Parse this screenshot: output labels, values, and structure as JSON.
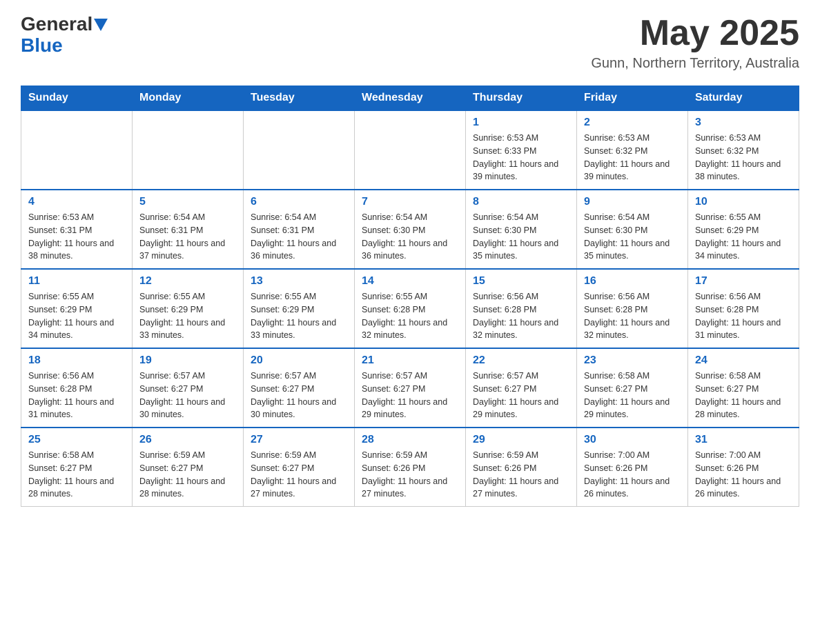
{
  "header": {
    "logo_general": "General",
    "logo_blue": "Blue",
    "month_title": "May 2025",
    "location": "Gunn, Northern Territory, Australia"
  },
  "days_of_week": [
    "Sunday",
    "Monday",
    "Tuesday",
    "Wednesday",
    "Thursday",
    "Friday",
    "Saturday"
  ],
  "weeks": [
    [
      {
        "day": "",
        "info": ""
      },
      {
        "day": "",
        "info": ""
      },
      {
        "day": "",
        "info": ""
      },
      {
        "day": "",
        "info": ""
      },
      {
        "day": "1",
        "info": "Sunrise: 6:53 AM\nSunset: 6:33 PM\nDaylight: 11 hours and 39 minutes."
      },
      {
        "day": "2",
        "info": "Sunrise: 6:53 AM\nSunset: 6:32 PM\nDaylight: 11 hours and 39 minutes."
      },
      {
        "day": "3",
        "info": "Sunrise: 6:53 AM\nSunset: 6:32 PM\nDaylight: 11 hours and 38 minutes."
      }
    ],
    [
      {
        "day": "4",
        "info": "Sunrise: 6:53 AM\nSunset: 6:31 PM\nDaylight: 11 hours and 38 minutes."
      },
      {
        "day": "5",
        "info": "Sunrise: 6:54 AM\nSunset: 6:31 PM\nDaylight: 11 hours and 37 minutes."
      },
      {
        "day": "6",
        "info": "Sunrise: 6:54 AM\nSunset: 6:31 PM\nDaylight: 11 hours and 36 minutes."
      },
      {
        "day": "7",
        "info": "Sunrise: 6:54 AM\nSunset: 6:30 PM\nDaylight: 11 hours and 36 minutes."
      },
      {
        "day": "8",
        "info": "Sunrise: 6:54 AM\nSunset: 6:30 PM\nDaylight: 11 hours and 35 minutes."
      },
      {
        "day": "9",
        "info": "Sunrise: 6:54 AM\nSunset: 6:30 PM\nDaylight: 11 hours and 35 minutes."
      },
      {
        "day": "10",
        "info": "Sunrise: 6:55 AM\nSunset: 6:29 PM\nDaylight: 11 hours and 34 minutes."
      }
    ],
    [
      {
        "day": "11",
        "info": "Sunrise: 6:55 AM\nSunset: 6:29 PM\nDaylight: 11 hours and 34 minutes."
      },
      {
        "day": "12",
        "info": "Sunrise: 6:55 AM\nSunset: 6:29 PM\nDaylight: 11 hours and 33 minutes."
      },
      {
        "day": "13",
        "info": "Sunrise: 6:55 AM\nSunset: 6:29 PM\nDaylight: 11 hours and 33 minutes."
      },
      {
        "day": "14",
        "info": "Sunrise: 6:55 AM\nSunset: 6:28 PM\nDaylight: 11 hours and 32 minutes."
      },
      {
        "day": "15",
        "info": "Sunrise: 6:56 AM\nSunset: 6:28 PM\nDaylight: 11 hours and 32 minutes."
      },
      {
        "day": "16",
        "info": "Sunrise: 6:56 AM\nSunset: 6:28 PM\nDaylight: 11 hours and 32 minutes."
      },
      {
        "day": "17",
        "info": "Sunrise: 6:56 AM\nSunset: 6:28 PM\nDaylight: 11 hours and 31 minutes."
      }
    ],
    [
      {
        "day": "18",
        "info": "Sunrise: 6:56 AM\nSunset: 6:28 PM\nDaylight: 11 hours and 31 minutes."
      },
      {
        "day": "19",
        "info": "Sunrise: 6:57 AM\nSunset: 6:27 PM\nDaylight: 11 hours and 30 minutes."
      },
      {
        "day": "20",
        "info": "Sunrise: 6:57 AM\nSunset: 6:27 PM\nDaylight: 11 hours and 30 minutes."
      },
      {
        "day": "21",
        "info": "Sunrise: 6:57 AM\nSunset: 6:27 PM\nDaylight: 11 hours and 29 minutes."
      },
      {
        "day": "22",
        "info": "Sunrise: 6:57 AM\nSunset: 6:27 PM\nDaylight: 11 hours and 29 minutes."
      },
      {
        "day": "23",
        "info": "Sunrise: 6:58 AM\nSunset: 6:27 PM\nDaylight: 11 hours and 29 minutes."
      },
      {
        "day": "24",
        "info": "Sunrise: 6:58 AM\nSunset: 6:27 PM\nDaylight: 11 hours and 28 minutes."
      }
    ],
    [
      {
        "day": "25",
        "info": "Sunrise: 6:58 AM\nSunset: 6:27 PM\nDaylight: 11 hours and 28 minutes."
      },
      {
        "day": "26",
        "info": "Sunrise: 6:59 AM\nSunset: 6:27 PM\nDaylight: 11 hours and 28 minutes."
      },
      {
        "day": "27",
        "info": "Sunrise: 6:59 AM\nSunset: 6:27 PM\nDaylight: 11 hours and 27 minutes."
      },
      {
        "day": "28",
        "info": "Sunrise: 6:59 AM\nSunset: 6:26 PM\nDaylight: 11 hours and 27 minutes."
      },
      {
        "day": "29",
        "info": "Sunrise: 6:59 AM\nSunset: 6:26 PM\nDaylight: 11 hours and 27 minutes."
      },
      {
        "day": "30",
        "info": "Sunrise: 7:00 AM\nSunset: 6:26 PM\nDaylight: 11 hours and 26 minutes."
      },
      {
        "day": "31",
        "info": "Sunrise: 7:00 AM\nSunset: 6:26 PM\nDaylight: 11 hours and 26 minutes."
      }
    ]
  ]
}
